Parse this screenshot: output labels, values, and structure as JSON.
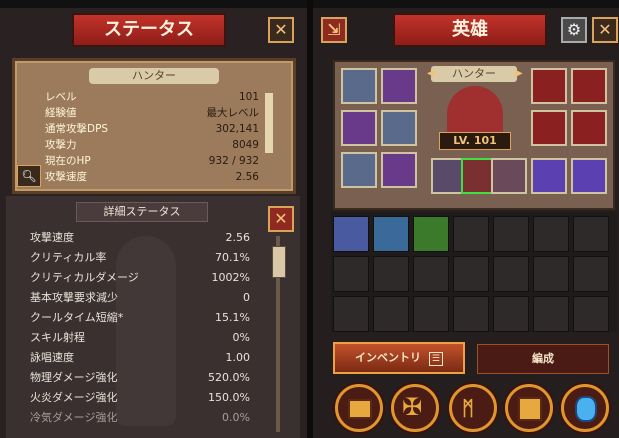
{
  "left_panel": {
    "title": "ステータス",
    "hunter_label": "ハンター",
    "stats": [
      {
        "label": "レベル",
        "value": "101"
      },
      {
        "label": "経験値",
        "value": "最大レベル"
      },
      {
        "label": "通常攻撃DPS",
        "value": "302,141"
      },
      {
        "label": "攻撃力",
        "value": "8049"
      },
      {
        "label": "現在のHP",
        "value": "932 / 932"
      },
      {
        "label": "攻撃速度",
        "value": "2.56"
      }
    ],
    "details_title": "詳細ステータス",
    "details": [
      {
        "label": "攻撃速度",
        "value": "2.56"
      },
      {
        "label": "クリティカル率",
        "value": "70.1%"
      },
      {
        "label": "クリティカルダメージ",
        "value": "1002%"
      },
      {
        "label": "基本攻撃要求減少",
        "value": "0"
      },
      {
        "label": "クールタイム短縮*",
        "value": "15.1%"
      },
      {
        "label": "スキル射程",
        "value": "0%"
      },
      {
        "label": "詠唱速度",
        "value": "1.00"
      },
      {
        "label": "物理ダメージ強化",
        "value": "520.0%"
      },
      {
        "label": "火炎ダメージ強化",
        "value": "150.0%"
      },
      {
        "label": "冷気ダメージ強化",
        "value": "0.0%"
      }
    ]
  },
  "right_panel": {
    "title": "英雄",
    "hero_name": "ハンター",
    "hero_level": "LV. 101",
    "inventory_tab": "インベントリ",
    "formation_tab": "編成",
    "bottom_buttons": [
      "chest-icon",
      "cross-icon",
      "rune-icon",
      "box-icon",
      "gem-icon"
    ]
  },
  "colors": {
    "accent_red": "#c2332a",
    "gold": "#e0962e",
    "parchment": "#9b7b5b"
  }
}
